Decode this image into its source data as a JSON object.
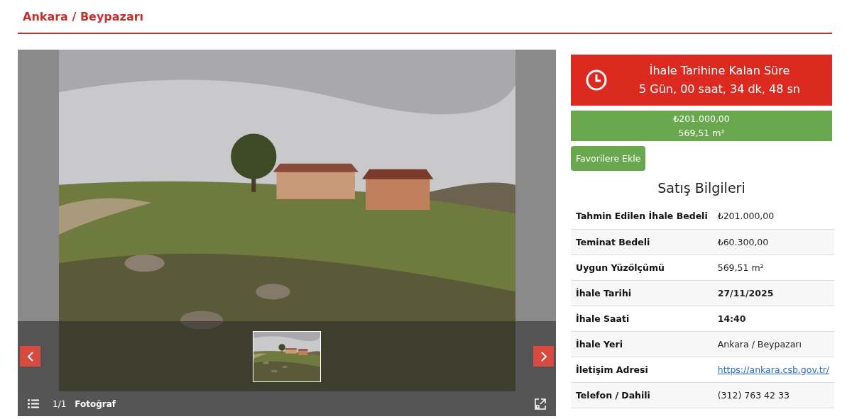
{
  "header": {
    "title": "Ankara / Beypazarı"
  },
  "gallery": {
    "counter": "1/1",
    "caption": "Fotoğraf",
    "thumbnails": [
      {
        "selected": true
      }
    ]
  },
  "countdown": {
    "title": "İhale Tarihine Kalan Süre",
    "remaining": "5 Gün, 00 saat, 34 dk, 48 sn"
  },
  "summary": {
    "price": "₺201.000,00",
    "area": "569,51 m²"
  },
  "favorite_button": "Favorilere Ekle",
  "details": {
    "title": "Satış Bilgileri",
    "rows": [
      {
        "label": "Tahmin Edilen İhale Bedeli",
        "value": "₺201.000,00",
        "kind": "plain"
      },
      {
        "label": "Teminat Bedeli",
        "value": "₺60.300,00",
        "kind": "plain"
      },
      {
        "label": "Uygun Yüzölçümü",
        "value": "569,51 m²",
        "kind": "plain"
      },
      {
        "label": "İhale Tarihi",
        "value": "27/11/2025",
        "kind": "bold"
      },
      {
        "label": "İhale Saati",
        "value": "14:40",
        "kind": "bold"
      },
      {
        "label": "İhale Yeri",
        "value": "Ankara / Beypazarı",
        "kind": "plain"
      },
      {
        "label": "İletişim Adresi",
        "value": "https://ankara.csb.gov.tr/",
        "kind": "link"
      },
      {
        "label": "Telefon / Dahili",
        "value": "(312) 763 42 33",
        "kind": "plain"
      }
    ]
  }
}
